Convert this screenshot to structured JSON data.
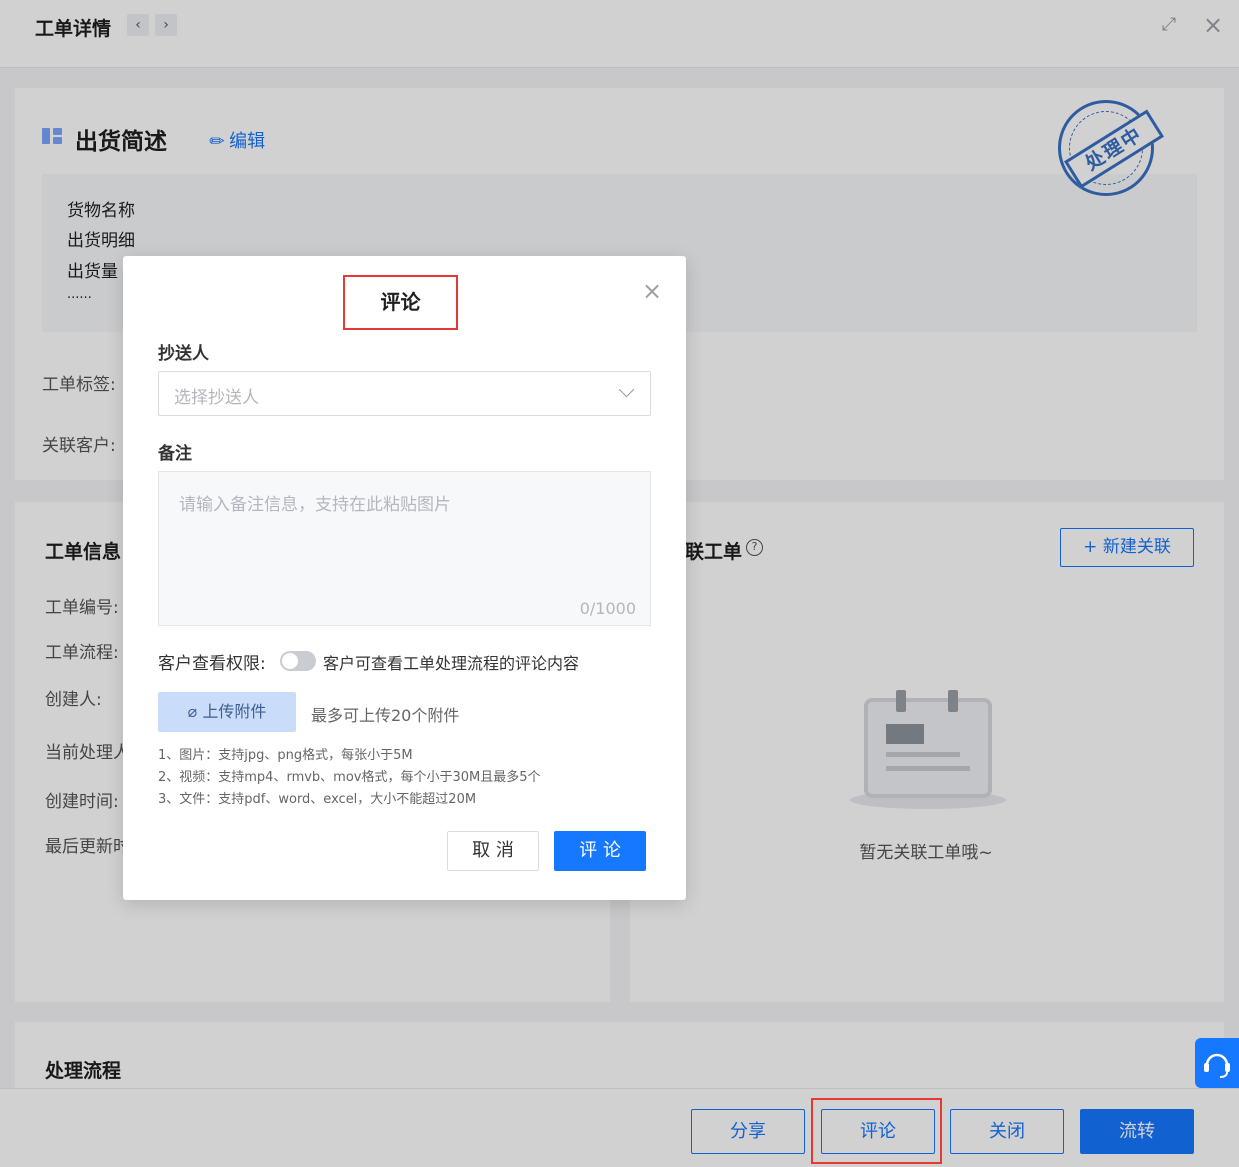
{
  "header": {
    "title": "工单详情",
    "prev_icon": "‹",
    "next_icon": "›",
    "fullscreen_icon": "⤢",
    "close_icon": "×"
  },
  "description": {
    "title": "出货简述",
    "edit_label": "编辑",
    "lines": [
      "货物名称",
      "出货明细",
      "出货量",
      "......"
    ],
    "tag_label": "工单标签:",
    "customer_label": "关联客户:",
    "stamp_text": "处理中"
  },
  "info": {
    "title": "工单信息",
    "fields": [
      "工单编号:",
      "工单流程:",
      "创建人:",
      "当前处理人",
      "创建时间:",
      "最后更新时"
    ]
  },
  "related": {
    "title": "联工单",
    "help_icon": "?",
    "new_button": "新建关联",
    "empty_text": "暂无关联工单哦~"
  },
  "flow": {
    "title": "处理流程"
  },
  "actions": {
    "share": "分享",
    "comment": "评论",
    "close": "关闭",
    "transfer": "流转"
  },
  "modal": {
    "title": "评论",
    "close_icon": "×",
    "cc_label": "抄送人",
    "cc_placeholder": "选择抄送人",
    "note_label": "备注",
    "note_placeholder": "请输入备注信息，支持在此粘贴图片",
    "note_count": "0/1000",
    "perm_label": "客户查看权限:",
    "perm_desc": "客户可查看工单处理流程的评论内容",
    "perm_enabled": false,
    "upload_label": "上传附件",
    "upload_hint": "最多可上传20个附件",
    "rules": [
      "1、图片：支持jpg、png格式，每张小于5M",
      "2、视频：支持mp4、rmvb、mov格式，每个小于30M且最多5个",
      "3、文件：支持pdf、word、excel，大小不能超过20M"
    ],
    "cancel_label": "取 消",
    "submit_label": "评 论"
  },
  "colors": {
    "primary": "#1677ff",
    "highlight": "#e53935",
    "stamp": "#3a6fc4"
  }
}
